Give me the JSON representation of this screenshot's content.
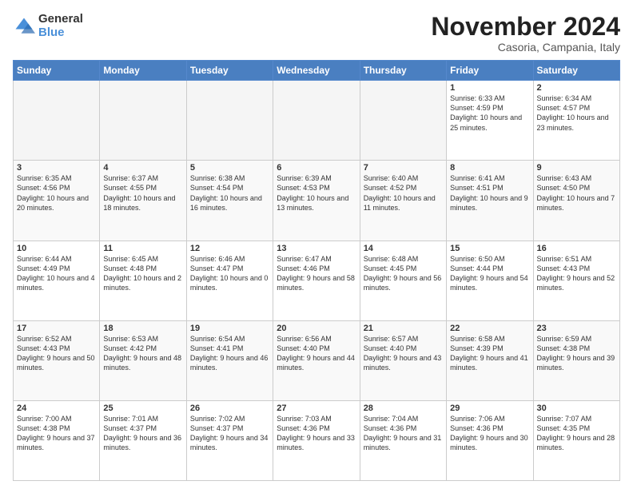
{
  "logo": {
    "general": "General",
    "blue": "Blue"
  },
  "header": {
    "month": "November 2024",
    "location": "Casoria, Campania, Italy"
  },
  "days_of_week": [
    "Sunday",
    "Monday",
    "Tuesday",
    "Wednesday",
    "Thursday",
    "Friday",
    "Saturday"
  ],
  "weeks": [
    [
      {
        "day": "",
        "info": ""
      },
      {
        "day": "",
        "info": ""
      },
      {
        "day": "",
        "info": ""
      },
      {
        "day": "",
        "info": ""
      },
      {
        "day": "",
        "info": ""
      },
      {
        "day": "1",
        "info": "Sunrise: 6:33 AM\nSunset: 4:59 PM\nDaylight: 10 hours and 25 minutes."
      },
      {
        "day": "2",
        "info": "Sunrise: 6:34 AM\nSunset: 4:57 PM\nDaylight: 10 hours and 23 minutes."
      }
    ],
    [
      {
        "day": "3",
        "info": "Sunrise: 6:35 AM\nSunset: 4:56 PM\nDaylight: 10 hours and 20 minutes."
      },
      {
        "day": "4",
        "info": "Sunrise: 6:37 AM\nSunset: 4:55 PM\nDaylight: 10 hours and 18 minutes."
      },
      {
        "day": "5",
        "info": "Sunrise: 6:38 AM\nSunset: 4:54 PM\nDaylight: 10 hours and 16 minutes."
      },
      {
        "day": "6",
        "info": "Sunrise: 6:39 AM\nSunset: 4:53 PM\nDaylight: 10 hours and 13 minutes."
      },
      {
        "day": "7",
        "info": "Sunrise: 6:40 AM\nSunset: 4:52 PM\nDaylight: 10 hours and 11 minutes."
      },
      {
        "day": "8",
        "info": "Sunrise: 6:41 AM\nSunset: 4:51 PM\nDaylight: 10 hours and 9 minutes."
      },
      {
        "day": "9",
        "info": "Sunrise: 6:43 AM\nSunset: 4:50 PM\nDaylight: 10 hours and 7 minutes."
      }
    ],
    [
      {
        "day": "10",
        "info": "Sunrise: 6:44 AM\nSunset: 4:49 PM\nDaylight: 10 hours and 4 minutes."
      },
      {
        "day": "11",
        "info": "Sunrise: 6:45 AM\nSunset: 4:48 PM\nDaylight: 10 hours and 2 minutes."
      },
      {
        "day": "12",
        "info": "Sunrise: 6:46 AM\nSunset: 4:47 PM\nDaylight: 10 hours and 0 minutes."
      },
      {
        "day": "13",
        "info": "Sunrise: 6:47 AM\nSunset: 4:46 PM\nDaylight: 9 hours and 58 minutes."
      },
      {
        "day": "14",
        "info": "Sunrise: 6:48 AM\nSunset: 4:45 PM\nDaylight: 9 hours and 56 minutes."
      },
      {
        "day": "15",
        "info": "Sunrise: 6:50 AM\nSunset: 4:44 PM\nDaylight: 9 hours and 54 minutes."
      },
      {
        "day": "16",
        "info": "Sunrise: 6:51 AM\nSunset: 4:43 PM\nDaylight: 9 hours and 52 minutes."
      }
    ],
    [
      {
        "day": "17",
        "info": "Sunrise: 6:52 AM\nSunset: 4:43 PM\nDaylight: 9 hours and 50 minutes."
      },
      {
        "day": "18",
        "info": "Sunrise: 6:53 AM\nSunset: 4:42 PM\nDaylight: 9 hours and 48 minutes."
      },
      {
        "day": "19",
        "info": "Sunrise: 6:54 AM\nSunset: 4:41 PM\nDaylight: 9 hours and 46 minutes."
      },
      {
        "day": "20",
        "info": "Sunrise: 6:56 AM\nSunset: 4:40 PM\nDaylight: 9 hours and 44 minutes."
      },
      {
        "day": "21",
        "info": "Sunrise: 6:57 AM\nSunset: 4:40 PM\nDaylight: 9 hours and 43 minutes."
      },
      {
        "day": "22",
        "info": "Sunrise: 6:58 AM\nSunset: 4:39 PM\nDaylight: 9 hours and 41 minutes."
      },
      {
        "day": "23",
        "info": "Sunrise: 6:59 AM\nSunset: 4:38 PM\nDaylight: 9 hours and 39 minutes."
      }
    ],
    [
      {
        "day": "24",
        "info": "Sunrise: 7:00 AM\nSunset: 4:38 PM\nDaylight: 9 hours and 37 minutes."
      },
      {
        "day": "25",
        "info": "Sunrise: 7:01 AM\nSunset: 4:37 PM\nDaylight: 9 hours and 36 minutes."
      },
      {
        "day": "26",
        "info": "Sunrise: 7:02 AM\nSunset: 4:37 PM\nDaylight: 9 hours and 34 minutes."
      },
      {
        "day": "27",
        "info": "Sunrise: 7:03 AM\nSunset: 4:36 PM\nDaylight: 9 hours and 33 minutes."
      },
      {
        "day": "28",
        "info": "Sunrise: 7:04 AM\nSunset: 4:36 PM\nDaylight: 9 hours and 31 minutes."
      },
      {
        "day": "29",
        "info": "Sunrise: 7:06 AM\nSunset: 4:36 PM\nDaylight: 9 hours and 30 minutes."
      },
      {
        "day": "30",
        "info": "Sunrise: 7:07 AM\nSunset: 4:35 PM\nDaylight: 9 hours and 28 minutes."
      }
    ]
  ]
}
